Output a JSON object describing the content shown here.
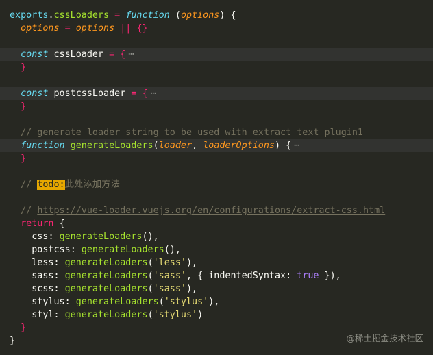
{
  "editor": {
    "colors": {
      "background": "#272822",
      "line_highlight": "#323330",
      "todo_highlight": "#e6a700"
    },
    "lines": [
      {
        "indent": 0,
        "tokens": [
          {
            "t": "exports",
            "c": "var"
          },
          {
            "t": ".",
            "c": "punc"
          },
          {
            "t": "cssLoaders",
            "c": "prop"
          },
          {
            "t": " = ",
            "c": "op"
          },
          {
            "t": "function",
            "c": "kw"
          },
          {
            "t": " (",
            "c": "punc"
          },
          {
            "t": "options",
            "c": "param"
          },
          {
            "t": ") {",
            "c": "punc"
          }
        ]
      },
      {
        "indent": 1,
        "tokens": [
          {
            "t": "options",
            "c": "param"
          },
          {
            "t": " = ",
            "c": "op"
          },
          {
            "t": "options",
            "c": "param"
          },
          {
            "t": " || ",
            "c": "op"
          },
          {
            "t": "{}",
            "c": "brace"
          }
        ]
      },
      {
        "indent": 0,
        "tokens": []
      },
      {
        "indent": 1,
        "highlight": true,
        "tokens": [
          {
            "t": "const",
            "c": "kw"
          },
          {
            "t": " ",
            "c": "punc"
          },
          {
            "t": "cssLoader",
            "c": "name"
          },
          {
            "t": " = ",
            "c": "op"
          },
          {
            "t": "{",
            "c": "brace"
          },
          {
            "t": "⋯",
            "c": "fold"
          }
        ]
      },
      {
        "indent": 1,
        "tokens": [
          {
            "t": "}",
            "c": "brace"
          }
        ]
      },
      {
        "indent": 0,
        "tokens": []
      },
      {
        "indent": 1,
        "highlight": true,
        "tokens": [
          {
            "t": "const",
            "c": "kw"
          },
          {
            "t": " ",
            "c": "punc"
          },
          {
            "t": "postcssLoader",
            "c": "name"
          },
          {
            "t": " = ",
            "c": "op"
          },
          {
            "t": "{",
            "c": "brace"
          },
          {
            "t": "⋯",
            "c": "fold"
          }
        ]
      },
      {
        "indent": 1,
        "tokens": [
          {
            "t": "}",
            "c": "brace"
          }
        ]
      },
      {
        "indent": 0,
        "tokens": []
      },
      {
        "indent": 1,
        "tokens": [
          {
            "t": "// generate loader string to be used with extract text plugin1",
            "c": "comment"
          }
        ]
      },
      {
        "indent": 1,
        "highlight": true,
        "tokens": [
          {
            "t": "function",
            "c": "kw"
          },
          {
            "t": " ",
            "c": "punc"
          },
          {
            "t": "generateLoaders",
            "c": "func"
          },
          {
            "t": "(",
            "c": "punc"
          },
          {
            "t": "loader",
            "c": "param"
          },
          {
            "t": ", ",
            "c": "punc"
          },
          {
            "t": "loaderOptions",
            "c": "param"
          },
          {
            "t": ") {",
            "c": "punc"
          },
          {
            "t": "⋯",
            "c": "fold"
          }
        ]
      },
      {
        "indent": 1,
        "tokens": [
          {
            "t": "}",
            "c": "brace"
          }
        ]
      },
      {
        "indent": 0,
        "tokens": []
      },
      {
        "indent": 1,
        "tokens": [
          {
            "t": "// ",
            "c": "comment"
          },
          {
            "t": "todo:",
            "c": "todo"
          },
          {
            "t": "此处添加方法",
            "c": "cjk"
          }
        ]
      },
      {
        "indent": 0,
        "tokens": []
      },
      {
        "indent": 1,
        "tokens": [
          {
            "t": "// ",
            "c": "comment"
          },
          {
            "t": "https://vue-loader.vuejs.org/en/configurations/extract-css.html",
            "c": "link"
          }
        ]
      },
      {
        "indent": 1,
        "tokens": [
          {
            "t": "return",
            "c": "kwr"
          },
          {
            "t": " {",
            "c": "punc"
          }
        ]
      },
      {
        "indent": 2,
        "tokens": [
          {
            "t": "css",
            "c": "key"
          },
          {
            "t": ": ",
            "c": "punc"
          },
          {
            "t": "generateLoaders",
            "c": "func"
          },
          {
            "t": "(),",
            "c": "punc"
          }
        ]
      },
      {
        "indent": 2,
        "tokens": [
          {
            "t": "postcss",
            "c": "key"
          },
          {
            "t": ": ",
            "c": "punc"
          },
          {
            "t": "generateLoaders",
            "c": "func"
          },
          {
            "t": "(),",
            "c": "punc"
          }
        ]
      },
      {
        "indent": 2,
        "tokens": [
          {
            "t": "less",
            "c": "key"
          },
          {
            "t": ": ",
            "c": "punc"
          },
          {
            "t": "generateLoaders",
            "c": "func"
          },
          {
            "t": "(",
            "c": "punc"
          },
          {
            "t": "'less'",
            "c": "str"
          },
          {
            "t": "),",
            "c": "punc"
          }
        ]
      },
      {
        "indent": 2,
        "tokens": [
          {
            "t": "sass",
            "c": "key"
          },
          {
            "t": ": ",
            "c": "punc"
          },
          {
            "t": "generateLoaders",
            "c": "func"
          },
          {
            "t": "(",
            "c": "punc"
          },
          {
            "t": "'sass'",
            "c": "str"
          },
          {
            "t": ", { ",
            "c": "punc"
          },
          {
            "t": "indentedSyntax",
            "c": "key"
          },
          {
            "t": ": ",
            "c": "punc"
          },
          {
            "t": "true",
            "c": "bool"
          },
          {
            "t": " }),",
            "c": "punc"
          }
        ]
      },
      {
        "indent": 2,
        "tokens": [
          {
            "t": "scss",
            "c": "key"
          },
          {
            "t": ": ",
            "c": "punc"
          },
          {
            "t": "generateLoaders",
            "c": "func"
          },
          {
            "t": "(",
            "c": "punc"
          },
          {
            "t": "'sass'",
            "c": "str"
          },
          {
            "t": "),",
            "c": "punc"
          }
        ]
      },
      {
        "indent": 2,
        "tokens": [
          {
            "t": "stylus",
            "c": "key"
          },
          {
            "t": ": ",
            "c": "punc"
          },
          {
            "t": "generateLoaders",
            "c": "func"
          },
          {
            "t": "(",
            "c": "punc"
          },
          {
            "t": "'stylus'",
            "c": "str"
          },
          {
            "t": "),",
            "c": "punc"
          }
        ]
      },
      {
        "indent": 2,
        "tokens": [
          {
            "t": "styl",
            "c": "key"
          },
          {
            "t": ": ",
            "c": "punc"
          },
          {
            "t": "generateLoaders",
            "c": "func"
          },
          {
            "t": "(",
            "c": "punc"
          },
          {
            "t": "'stylus'",
            "c": "str"
          },
          {
            "t": ")",
            "c": "punc"
          }
        ]
      },
      {
        "indent": 1,
        "tokens": [
          {
            "t": "}",
            "c": "brace"
          }
        ]
      },
      {
        "indent": 0,
        "tokens": [
          {
            "t": "}",
            "c": "punc"
          }
        ]
      }
    ]
  },
  "watermark": "@稀土掘金技术社区"
}
